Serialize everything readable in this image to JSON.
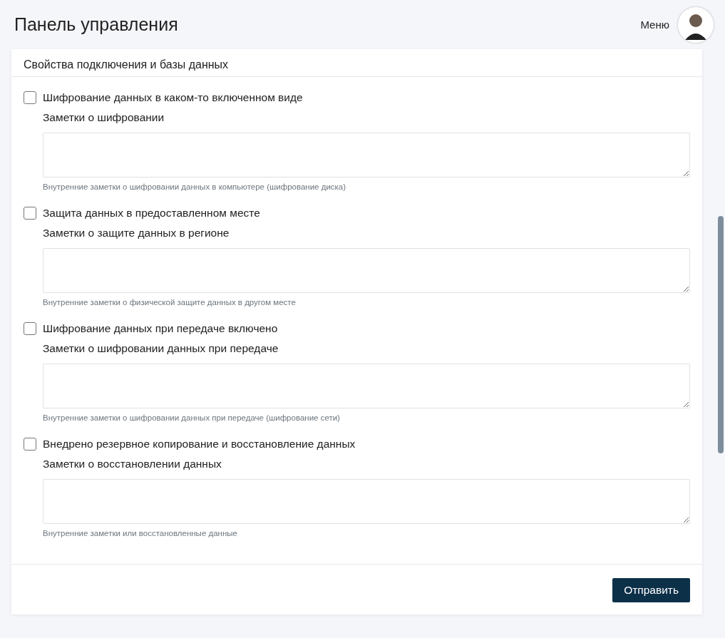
{
  "header": {
    "title": "Панель управления",
    "menu": "Меню"
  },
  "card": {
    "title": "Свойства подключения и базы данных",
    "items": [
      {
        "label": "Шифрование данных в каком-то включенном виде",
        "checked": false,
        "notes_label": "Заметки о шифровании",
        "help": "Внутренние заметки о шифровании данных в компьютере (шифрование диска)"
      },
      {
        "label": "Защита данных в предоставленном месте",
        "checked": false,
        "notes_label": "Заметки о защите данных в регионе",
        "help": "Внутренние заметки о физической защите данных в другом месте"
      },
      {
        "label": "Шифрование данных при передаче включено",
        "checked": false,
        "notes_label": "Заметки о шифровании данных при передаче",
        "help": "Внутренние заметки о шифровании данных при передаче (шифрование сети)"
      },
      {
        "label": "Внедрено резервное копирование и восстановление данных",
        "checked": false,
        "notes_label": "Заметки о восстановлении данных",
        "help": "Внутренние заметки или восстановленные данные"
      }
    ],
    "submit": "Отправить"
  }
}
